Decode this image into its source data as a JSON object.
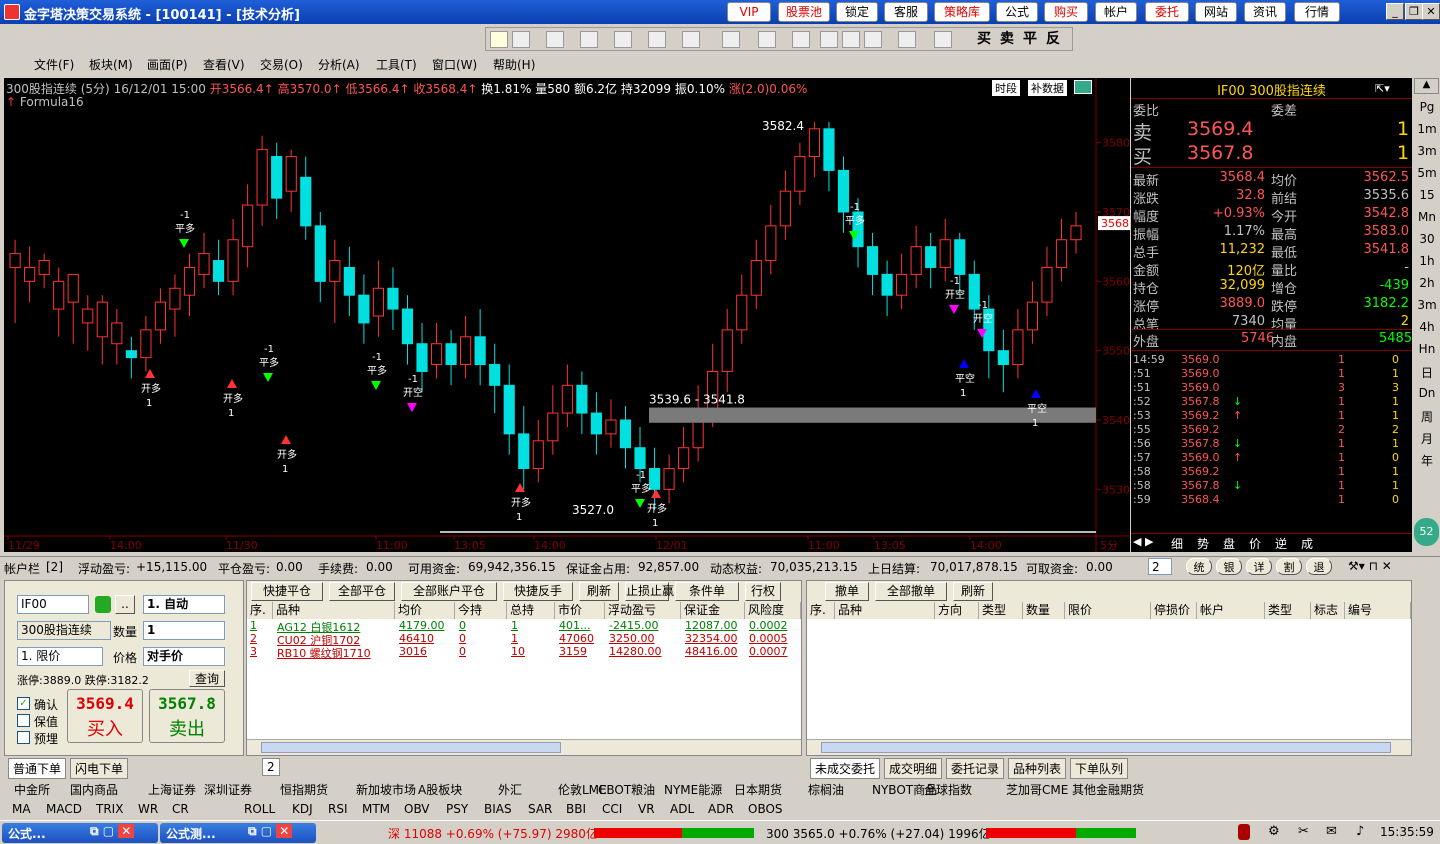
{
  "titlebar": {
    "title": "金字塔决策交易系统  -  [100141]  -  [技术分析]",
    "buttons": [
      "VIP",
      "股票池",
      "锁定",
      "客服",
      "策略库",
      "公式",
      "购买",
      "帐户",
      "委托",
      "网站",
      "资讯",
      "行情"
    ],
    "red": [
      0,
      1,
      4,
      6,
      8
    ]
  },
  "toolbar": {
    "trade_labels": [
      "买",
      "卖",
      "平",
      "反"
    ]
  },
  "menu": [
    "文件(F)",
    "板块(M)",
    "画面(P)",
    "查看(V)",
    "交易(O)",
    "分析(A)",
    "工具(T)",
    "窗口(W)",
    "帮助(H)"
  ],
  "chart": {
    "header": {
      "name": "300股指连续",
      "period": "(5分)",
      "date": "16/12/01 15:00",
      "open": "开3566.4",
      "high": "高3570.0",
      "low": "低3566.4",
      "close": "收3568.4",
      "chg_up": "↑",
      "turnover": "换1.81%",
      "vol": "量580",
      "amount": "额6.2亿",
      "oi": "持32099",
      "amp": "振0.10%",
      "rise": "涨(2.0)0.06%"
    },
    "formula": "Formula16",
    "buttons": [
      "时段",
      "补数据"
    ],
    "yticks": [
      "3580",
      "3570",
      "3560",
      "3550",
      "3540",
      "3530"
    ],
    "xticks": [
      "11/29",
      "14:00",
      "11/30",
      "11:00",
      "13:05",
      "14:00",
      "12/01",
      "11:00",
      "13:05",
      "14:00"
    ],
    "period_label": "5分",
    "last_price_tag": "3568",
    "annotations": {
      "high": "3582.4",
      "low": "3527.0",
      "range": "3539.6 - 3541.8"
    },
    "signal_texts": [
      "开多",
      "平多",
      "开空",
      "平空",
      "1",
      "-1"
    ]
  },
  "chart_data": {
    "type": "candlestick",
    "y_range": [
      3525,
      3585
    ],
    "high": 3582.4,
    "low": 3527.0,
    "last": 3568.4,
    "candles": [
      [
        3562,
        3564,
        3554,
        3566
      ],
      [
        3560,
        3562,
        3557,
        3565
      ],
      [
        3561,
        3563,
        3559,
        3564
      ],
      [
        3556,
        3560,
        3552,
        3562
      ],
      [
        3557,
        3561,
        3551,
        3559
      ],
      [
        3554,
        3556,
        3550,
        3558
      ],
      [
        3552,
        3557,
        3548,
        3558
      ],
      [
        3551,
        3554,
        3548,
        3556
      ],
      [
        3550,
        3549,
        3546,
        3552
      ],
      [
        3549,
        3553,
        3547,
        3555
      ],
      [
        3553,
        3557,
        3551,
        3559
      ],
      [
        3556,
        3559,
        3552,
        3561
      ],
      [
        3558,
        3562,
        3555,
        3564
      ],
      [
        3561,
        3564,
        3559,
        3567
      ],
      [
        3563,
        3560,
        3558,
        3566
      ],
      [
        3560,
        3566,
        3558,
        3569
      ],
      [
        3565,
        3571,
        3562,
        3574
      ],
      [
        3571,
        3579,
        3568,
        3581
      ],
      [
        3578,
        3572,
        3569,
        3580
      ],
      [
        3573,
        3578,
        3570,
        3579
      ],
      [
        3575,
        3568,
        3566,
        3578
      ],
      [
        3568,
        3560,
        3557,
        3570
      ],
      [
        3560,
        3563,
        3554,
        3566
      ],
      [
        3562,
        3558,
        3555,
        3565
      ],
      [
        3558,
        3554,
        3551,
        3561
      ],
      [
        3555,
        3559,
        3552,
        3563
      ],
      [
        3559,
        3556,
        3553,
        3562
      ],
      [
        3556,
        3551,
        3548,
        3558
      ],
      [
        3551,
        3547,
        3544,
        3554
      ],
      [
        3548,
        3551,
        3546,
        3554
      ],
      [
        3551,
        3548,
        3545,
        3553
      ],
      [
        3548,
        3552,
        3546,
        3555
      ],
      [
        3552,
        3548,
        3545,
        3556
      ],
      [
        3548,
        3545,
        3541,
        3551
      ],
      [
        3545,
        3538,
        3535,
        3548
      ],
      [
        3538,
        3533,
        3530,
        3542
      ],
      [
        3533,
        3537,
        3531,
        3540
      ],
      [
        3537,
        3541,
        3535,
        3545
      ],
      [
        3541,
        3545,
        3539,
        3548
      ],
      [
        3545,
        3541,
        3538,
        3547
      ],
      [
        3541,
        3538,
        3535,
        3544
      ],
      [
        3538,
        3540,
        3536,
        3543
      ],
      [
        3540,
        3536,
        3533,
        3542
      ],
      [
        3536,
        3533,
        3531,
        3539
      ],
      [
        3533,
        3530,
        3527,
        3536
      ],
      [
        3530,
        3533,
        3528,
        3535
      ],
      [
        3533,
        3536,
        3531,
        3539
      ],
      [
        3536,
        3541,
        3534,
        3545
      ],
      [
        3541,
        3547,
        3539,
        3551
      ],
      [
        3547,
        3553,
        3544,
        3556
      ],
      [
        3553,
        3558,
        3551,
        3561
      ],
      [
        3558,
        3563,
        3556,
        3566
      ],
      [
        3563,
        3568,
        3561,
        3571
      ],
      [
        3568,
        3573,
        3566,
        3576
      ],
      [
        3573,
        3578,
        3571,
        3580
      ],
      [
        3578,
        3582,
        3575,
        3583
      ],
      [
        3582,
        3576,
        3573,
        3583
      ],
      [
        3576,
        3570,
        3567,
        3578
      ],
      [
        3570,
        3565,
        3562,
        3572
      ],
      [
        3565,
        3561,
        3558,
        3567
      ],
      [
        3561,
        3558,
        3555,
        3563
      ],
      [
        3558,
        3561,
        3556,
        3564
      ],
      [
        3561,
        3565,
        3559,
        3568
      ],
      [
        3565,
        3562,
        3559,
        3567
      ],
      [
        3562,
        3566,
        3560,
        3569
      ],
      [
        3566,
        3561,
        3558,
        3567
      ],
      [
        3561,
        3556,
        3553,
        3563
      ],
      [
        3556,
        3550,
        3546,
        3558
      ],
      [
        3550,
        3548,
        3544,
        3553
      ],
      [
        3548,
        3553,
        3546,
        3556
      ],
      [
        3553,
        3557,
        3551,
        3560
      ],
      [
        3557,
        3562,
        3555,
        3565
      ],
      [
        3562,
        3566,
        3560,
        3569
      ],
      [
        3566,
        3568,
        3564,
        3570
      ]
    ]
  },
  "quote": {
    "title": "IF00  300股指连续",
    "weibi": "委比",
    "weicha": "委差",
    "sell": {
      "label": "卖",
      "price": "3569.4",
      "vol": "1"
    },
    "buy": {
      "label": "买",
      "price": "3567.8",
      "vol": "1"
    },
    "rows": [
      [
        "最新",
        "3568.4",
        "均价",
        "3562.5"
      ],
      [
        "涨跌",
        "32.8",
        "前结",
        "3535.6"
      ],
      [
        "幅度",
        "+0.93%",
        "今开",
        "3542.8"
      ],
      [
        "振幅",
        "1.17%",
        "最高",
        "3583.0"
      ],
      [
        "总手",
        "11,232",
        "最低",
        "3541.8"
      ],
      [
        "金额",
        "120亿",
        "量比",
        "-"
      ],
      [
        "持仓",
        "32,099",
        "增仓",
        "-439"
      ],
      [
        "涨停",
        "3889.0",
        "跌停",
        "3182.2"
      ],
      [
        "总笔",
        "7340",
        "均量",
        "2"
      ]
    ],
    "waipan": [
      "外盘",
      "5746",
      "内盘",
      "5485"
    ],
    "ticks": [
      [
        "14:59",
        "3569.0",
        "",
        "1",
        "0"
      ],
      [
        ":51",
        "3569.0",
        "",
        "1",
        "1"
      ],
      [
        ":51",
        "3569.0",
        "",
        "3",
        "3"
      ],
      [
        ":52",
        "3567.8",
        "↓",
        "1",
        "1"
      ],
      [
        ":53",
        "3569.2",
        "↑",
        "1",
        "1"
      ],
      [
        ":55",
        "3569.2",
        "",
        "2",
        "2"
      ],
      [
        ":56",
        "3567.8",
        "↓",
        "1",
        "1"
      ],
      [
        ":57",
        "3569.0",
        "↑",
        "1",
        "0"
      ],
      [
        ":58",
        "3569.2",
        "",
        "1",
        "1"
      ],
      [
        ":58",
        "3567.8",
        "↓",
        "1",
        "1"
      ],
      [
        ":59",
        "3568.4",
        "",
        "1",
        "0"
      ]
    ],
    "bottom_tabs": [
      "细",
      "势",
      "盘",
      "价",
      "逆",
      "成"
    ]
  },
  "sidetabs": [
    "Pg",
    "1m",
    "3m",
    "5m",
    "15",
    "Mn",
    "30",
    "1h",
    "2h",
    "3m",
    "4h",
    "Hn",
    "日",
    "Dn",
    "周",
    "月",
    "年"
  ],
  "account": {
    "label": "帐户栏",
    "count": "[2]",
    "float_label": "浮动盈亏:",
    "float": "+15,115.00",
    "close_label": "平仓盈亏:",
    "close": "0.00",
    "fee_label": "手续费:",
    "fee": "0.00",
    "avail_label": "可用资金:",
    "avail": "69,942,356.15",
    "margin_label": "保证金占用:",
    "margin": "92,857.00",
    "dyn_label": "动态权益:",
    "dyn": "70,035,213.15",
    "prev_label": "上日结算:",
    "prev": "70,017,878.15",
    "withdraw_label": "可取资金:",
    "withdraw": "0.00",
    "sel": "2",
    "btns": [
      "统",
      "银",
      "详",
      "割",
      "退"
    ]
  },
  "order": {
    "symbol": "IF00",
    "name": "300股指连续",
    "mode": "1. 自动",
    "qty_label": "数量",
    "qty": "1",
    "type": "1. 限价",
    "price_label": "价格",
    "price": "对手价",
    "limits": "涨停:3889.0 跌停:3182.2",
    "query": "查询",
    "confirm": "确认",
    "keep": "保值",
    "preset": "预埋",
    "buy_price": "3569.4",
    "buy_label": "买入",
    "sell_price": "3567.8",
    "sell_label": "卖出"
  },
  "pos_buttons": [
    "快捷平仓",
    "全部平仓",
    "全部账户平仓",
    "快捷反手",
    "刷新",
    "止损止赢",
    "条件单",
    "行权"
  ],
  "pos_headers": [
    "序.",
    "品种",
    "均价",
    "今持",
    "总持",
    "市价",
    "浮动盈亏",
    "保证金",
    "风险度"
  ],
  "positions": [
    [
      "1",
      "AG12 白银1612",
      "4179.00",
      "0",
      "1",
      "401...",
      "-2415.00",
      "12087.00",
      "0.0002"
    ],
    [
      "2",
      "CU02 沪铜1702",
      "46410",
      "0",
      "1",
      "47060",
      "3250.00",
      "32354.00",
      "0.0005"
    ],
    [
      "3",
      "RB10 螺纹钢1710",
      "3016",
      "0",
      "10",
      "3159",
      "14280.00",
      "48416.00",
      "0.0007"
    ]
  ],
  "ord_buttons": [
    "撤单",
    "全部撤单",
    "刷新"
  ],
  "ord_headers": [
    "序.",
    "品种",
    "方向",
    "类型",
    "数量",
    "限价",
    "停损价",
    "帐户",
    "类型",
    "标志",
    "编号"
  ],
  "bottom_left_tabs": [
    "普通下单",
    "闪电下单"
  ],
  "mid_tab": "2",
  "right_tabs": [
    "未成交委托",
    "成交明细",
    "委托记录",
    "品种列表",
    "下单队列"
  ],
  "markets": [
    "中金所",
    "国内商品",
    "上海证券",
    "深圳证券",
    "恒指期货",
    "新加坡市场",
    "A股板块",
    "外汇",
    "伦敦LME",
    "CBOT粮油",
    "NYME能源",
    "日本期货",
    "棕榈油",
    "NYBOT商品",
    "全球指数",
    "芝加哥CME",
    "其他金融期货"
  ],
  "indicators": [
    "MA",
    "MACD",
    "TRIX",
    "WR",
    "CR",
    "ROLL",
    "KDJ",
    "RSI",
    "MTM",
    "OBV",
    "PSY",
    "BIAS",
    "SAR",
    "BBI",
    "CCI",
    "VR",
    "ADL",
    "ADR",
    "OBOS"
  ],
  "status": {
    "tasks": [
      "公式...",
      "公式测..."
    ],
    "shen": "深 11088 +0.69% (+75.97) 2980亿",
    "hs300": "300 3565.0 +0.76% (+27.04) 1996亿",
    "time": "15:35:59"
  }
}
